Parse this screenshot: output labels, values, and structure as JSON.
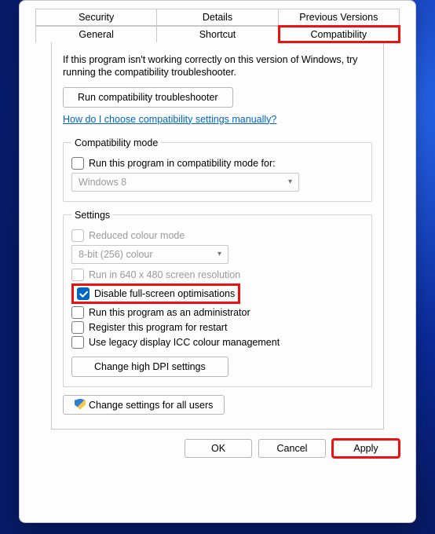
{
  "tabs": {
    "row1": [
      "Security",
      "Details",
      "Previous Versions"
    ],
    "row2": [
      "General",
      "Shortcut",
      "Compatibility"
    ]
  },
  "intro": "If this program isn't working correctly on this version of Windows, try running the compatibility troubleshooter.",
  "troubleshooter_btn": "Run compatibility troubleshooter",
  "help_link": "How do I choose compatibility settings manually?",
  "compat_mode": {
    "legend": "Compatibility mode",
    "checkbox": "Run this program in compatibility mode for:",
    "select": "Windows 8"
  },
  "settings": {
    "legend": "Settings",
    "reduced_colour": "Reduced colour mode",
    "colour_select": "8-bit (256) colour",
    "low_res": "Run in 640 x 480 screen resolution",
    "disable_fso": "Disable full-screen optimisations",
    "run_admin": "Run this program as an administrator",
    "register_restart": "Register this program for restart",
    "use_legacy_icc": "Use legacy display ICC colour management",
    "dpi_btn": "Change high DPI settings"
  },
  "all_users_btn": "Change settings for all users",
  "footer": {
    "ok": "OK",
    "cancel": "Cancel",
    "apply": "Apply"
  }
}
